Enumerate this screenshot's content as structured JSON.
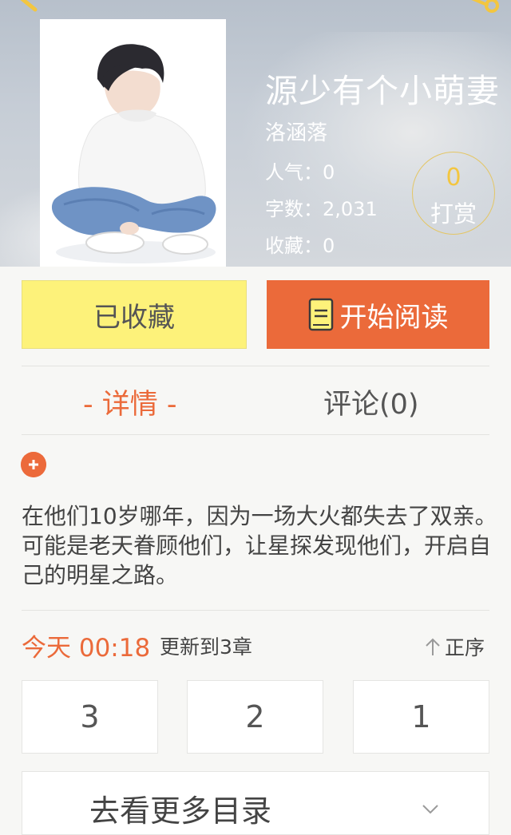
{
  "book": {
    "title": "源少有个小萌妻",
    "author": "洛涵落",
    "popularity_label": "人气：",
    "popularity": "0",
    "word_count_label": "字数：",
    "word_count": "2,031",
    "favorites_label": "收藏：",
    "favorites": "0",
    "tip": {
      "count": "0",
      "label": "打赏"
    },
    "synopsis": "在他们10岁哪年，因为一场大火都失去了双亲。可能是老天眷顾他们，让星探发现他们，开启自己的明星之路。"
  },
  "actions": {
    "favorite_label": "已收藏",
    "read_label": "开始阅读"
  },
  "tabs": [
    {
      "label": "- 详情 -",
      "active": true
    },
    {
      "label": "评论(0)",
      "active": false
    }
  ],
  "update": {
    "date": "今天 00:18",
    "text": "更新到3章",
    "sort_label": "正序"
  },
  "chapters": [
    "3",
    "2",
    "1"
  ],
  "more_catalog_label": "去看更多目录",
  "icons": {
    "back": "back-arrow-icon",
    "share": "share-icon",
    "book": "book-icon",
    "plus": "plus-icon",
    "sort": "up-arrow-icon",
    "chevron": "chevron-down-icon"
  },
  "colors": {
    "accent": "#eb6a3a",
    "favorite_button": "#fdf27a",
    "tip_count": "#f3c640"
  }
}
